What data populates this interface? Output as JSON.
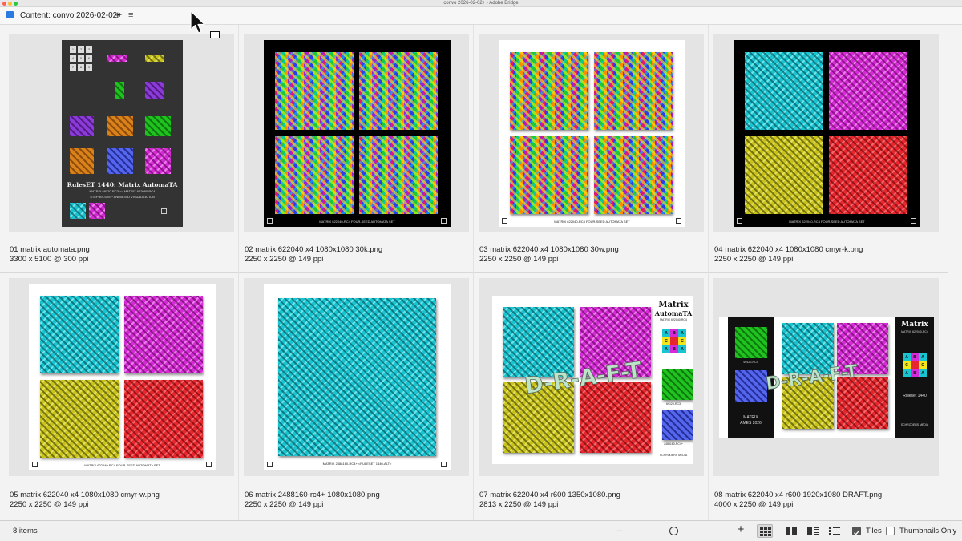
{
  "window": {
    "title": "convo 2026-02-02+ - Adobe Bridge"
  },
  "panel": {
    "label": "Content: convo 2026-02-02+",
    "add_symbol": "+",
    "menu_symbol": "≡"
  },
  "colors": {
    "accent": "#2b7ae0",
    "close": "#fe5f57",
    "minimize": "#febc2e",
    "maximize": "#28c840"
  },
  "items": [
    {
      "name": "01 matrix automata.png",
      "dimensions": "3300 x 5100 @ 300 ppi",
      "art": {
        "title": "RulesET 1440: Matrix AutomaTA",
        "subtitle": "MATRIX 69120-RC3 >> MATRIX 622080-RC4",
        "line": "STEP-BY-STEP ANIMATED VISUALIZATION"
      }
    },
    {
      "name": "02 matrix 622040 x4 1080x1080 30k.png",
      "dimensions": "2250 x 2250 @ 149 ppi",
      "art": {
        "caption": "MATRIX 622040-RC4 FOUR-SEED AUTOMATA SET"
      }
    },
    {
      "name": "03 matrix 622040 x4 1080x1080 30w.png",
      "dimensions": "2250 x 2250 @ 149 ppi",
      "art": {
        "caption": "MATRIX 622040-RC4 FOUR-SEED AUTOMATA SET"
      }
    },
    {
      "name": "04 matrix 622040 x4 1080x1080 cmyr-k.png",
      "dimensions": "2250 x 2250 @ 149 ppi",
      "art": {
        "caption": "MATRIX 622040-RC4 FOUR-SEED AUTOMATA SET"
      }
    },
    {
      "name": "05 matrix 622040 x4 1080x1080 cmyr-w.png",
      "dimensions": "2250 x 2250 @ 149 ppi",
      "art": {
        "caption": "MATRIX 622040-RC4 FOUR-SEED AUTOMATA SET"
      }
    },
    {
      "name": "06 matrix 2488160-rc4+ 1080x1080.png",
      "dimensions": "2250 x 2250 @ 149 ppi",
      "art": {
        "caption": "MATRIX 2488160-RC4+ <RULESET 1440-ALT>"
      }
    },
    {
      "name": "07 matrix 622040 x4 r600 1350x1080.png",
      "dimensions": "2813 x 2250 @ 149 ppi",
      "art": {
        "title_1": "Matrix",
        "title_2": "AutomaTA",
        "sub": "MATRIX 622040-RC4",
        "label_a": "69120-RC3",
        "label_b": "2488160-RC4+",
        "footer": "SCHRODERS MEDIA",
        "watermark": "D-R-A-F-T",
        "grid": [
          "A",
          "B",
          "A",
          "C",
          "",
          "C",
          "A",
          "B",
          "A"
        ]
      }
    },
    {
      "name": "08 matrix 622040 x4 r600 1920x1080 DRAFT.png",
      "dimensions": "4000 x 2250 @ 149 ppi",
      "art": {
        "title_1": "Matrix",
        "sub": "MATRIX 622040-RC4",
        "label_a": "69120-RC3",
        "label_b": "2488160-RC4+",
        "ruleset": "Ruleset 1440",
        "badge_1": "MATRIX",
        "badge_2": "AMES 2026",
        "footer": "SCHRODERS MEDIA",
        "watermark": "D-R-A-F-T",
        "grid": [
          "A",
          "B",
          "A",
          "C",
          "",
          "C",
          "A",
          "B",
          "A"
        ]
      }
    }
  ],
  "statusbar": {
    "count": "8 items",
    "zoom_minus": "−",
    "zoom_plus": "+",
    "zoom_level": 0.42,
    "tiles_label": "Tiles",
    "tiles_checked": true,
    "thumbs_only_label": "Thumbnails Only",
    "thumbs_only_checked": false
  }
}
